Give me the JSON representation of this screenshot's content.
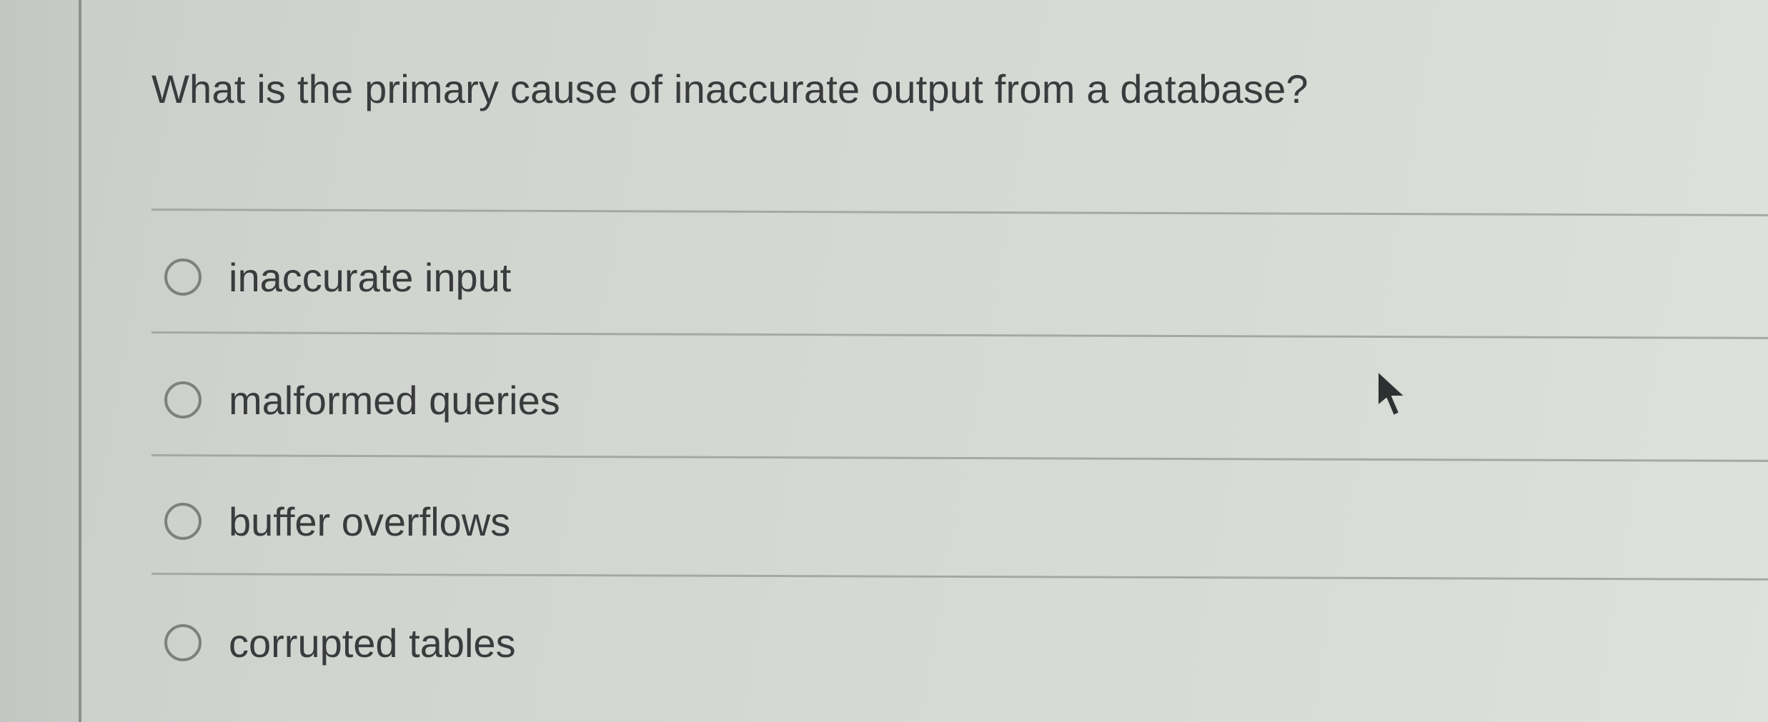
{
  "question": {
    "text": "What is the primary cause of inaccurate output from a database?"
  },
  "options": [
    {
      "label": "inaccurate input",
      "selected": false
    },
    {
      "label": "malformed queries",
      "selected": false
    },
    {
      "label": "buffer overflows",
      "selected": false
    },
    {
      "label": "corrupted tables",
      "selected": false
    }
  ],
  "icons": {
    "radio": "radio-unselected-icon",
    "cursor": "mouse-pointer-icon"
  },
  "colors": {
    "background": "#d6d8d4",
    "text": "#3a3b3d",
    "divider": "#a6a8a4",
    "radio_border": "#7e807e"
  }
}
